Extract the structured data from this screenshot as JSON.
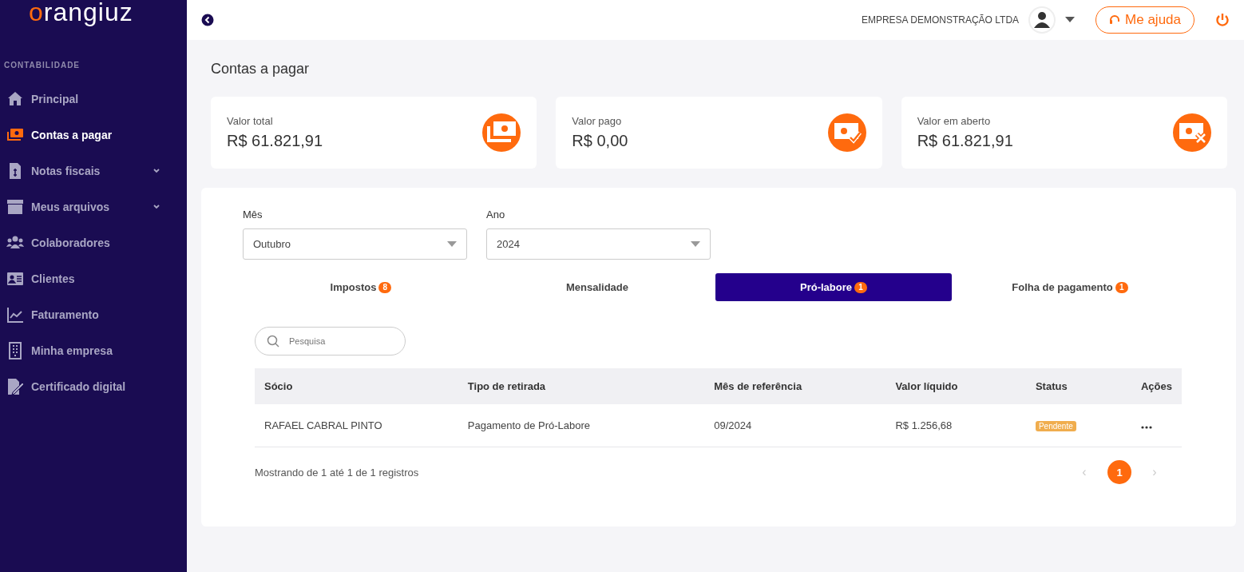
{
  "sidebar": {
    "logo": "orangiuz",
    "section": "CONTABILIDADE",
    "items": [
      {
        "label": "Principal",
        "selected": false,
        "submenu": false
      },
      {
        "label": "Contas a pagar",
        "selected": true,
        "submenu": false
      },
      {
        "label": "Notas fiscais",
        "selected": false,
        "submenu": true
      },
      {
        "label": "Meus arquivos",
        "selected": false,
        "submenu": true
      },
      {
        "label": "Colaboradores",
        "selected": false,
        "submenu": false
      },
      {
        "label": "Clientes",
        "selected": false,
        "submenu": false
      },
      {
        "label": "Faturamento",
        "selected": false,
        "submenu": false
      },
      {
        "label": "Minha empresa",
        "selected": false,
        "submenu": false
      },
      {
        "label": "Certificado digital",
        "selected": false,
        "submenu": false
      }
    ]
  },
  "topbar": {
    "company": "EMPRESA DEMONSTRAÇÃO LTDA",
    "help_button": "Me ajuda"
  },
  "page_title": "Contas a pagar",
  "cards": [
    {
      "label": "Valor total",
      "value": "R$ 61.821,91"
    },
    {
      "label": "Valor pago",
      "value": "R$ 0,00"
    },
    {
      "label": "Valor em aberto",
      "value": "R$ 61.821,91"
    }
  ],
  "filters": [
    {
      "label": "Mês",
      "value": "Outubro"
    },
    {
      "label": "Ano",
      "value": "2024"
    }
  ],
  "tabs": [
    {
      "label": "Impostos",
      "count": "8",
      "selected": false
    },
    {
      "label": "Mensalidade",
      "selected": false
    },
    {
      "label": "Pró-labore",
      "count": "1",
      "selected": true
    },
    {
      "label": "Folha de pagamento",
      "count": "1",
      "selected": false
    }
  ],
  "search": {
    "placeholder": "Pesquisa"
  },
  "table": {
    "columns": [
      "Sócio",
      "Tipo de retirada",
      "Mês de referência",
      "Valor líquido",
      "Status",
      "Ações"
    ],
    "rows": [
      {
        "cells": [
          "RAFAEL CABRAL PINTO",
          "Pagamento de Pró-Labore",
          "09/2024",
          "R$ 1.256,68"
        ],
        "status": "Pendente"
      }
    ]
  },
  "footer": "Mostrando de 1 até 1 de 1 registros",
  "pagination": [
    {
      "label": "‹",
      "disabled": true,
      "selected": false
    },
    {
      "label": "1",
      "disabled": false,
      "selected": true
    },
    {
      "label": "›",
      "disabled": true,
      "selected": false
    }
  ]
}
